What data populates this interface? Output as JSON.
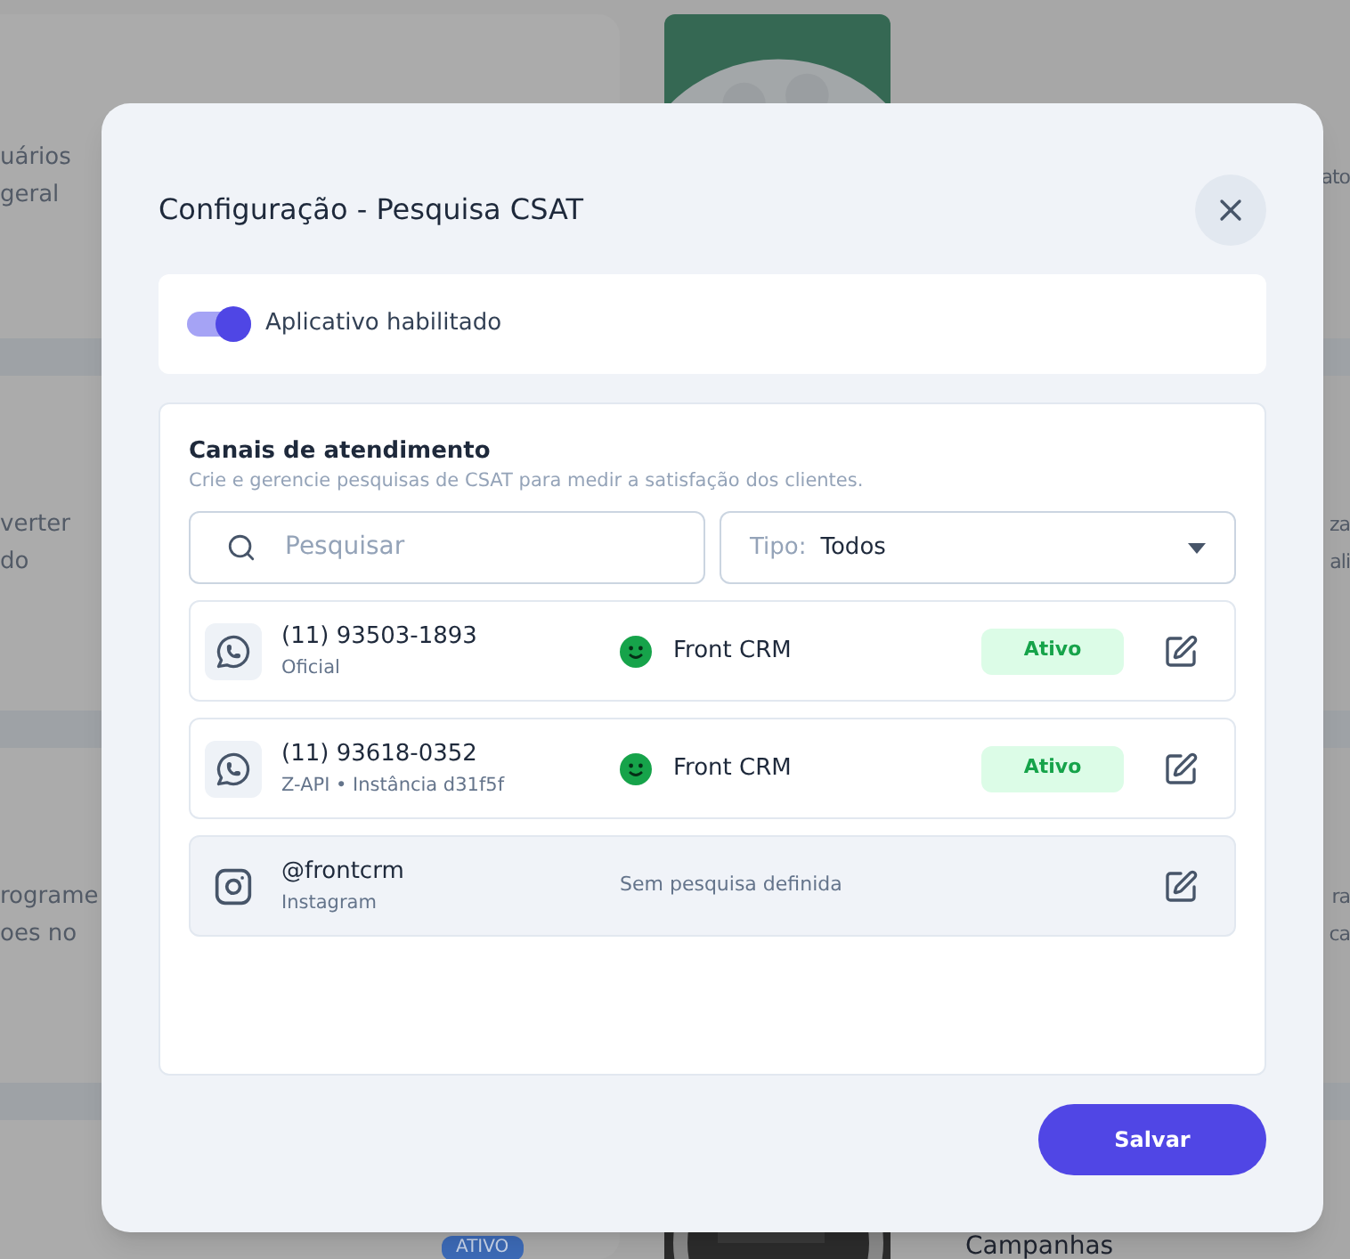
{
  "background": {
    "rows": [
      {
        "left_lines": [
          "uários",
          "geral"
        ],
        "right_lines": [
          "ato"
        ],
        "media": {
          "kind": "picture"
        }
      },
      {
        "left_lines": [
          "verter",
          "do"
        ],
        "right_lines": [
          "za",
          "ali"
        ]
      },
      {
        "left_lines": [
          "rograme",
          "oes no"
        ],
        "right_lines": [
          "ra",
          "ca"
        ]
      },
      {
        "badge": "ATIVO",
        "right_title": "Campanhas",
        "media": {
          "kind": "picture"
        }
      }
    ]
  },
  "dialog": {
    "title": "Configuração - Pesquisa CSAT",
    "app_toggle": {
      "label": "Aplicativo habilitado",
      "on": true
    },
    "channels_section": {
      "title": "Canais de atendimento",
      "subtitle": "Crie e gerencie pesquisas de CSAT para medir a satisfação dos clientes.",
      "search": {
        "placeholder": "Pesquisar"
      },
      "type_filter": {
        "label": "Tipo:",
        "value": "Todos"
      },
      "channels": [
        {
          "kind": "whatsapp",
          "name": "(11) 93503-1893",
          "detail": "Oficial",
          "survey": "Front CRM",
          "status": "Ativo"
        },
        {
          "kind": "whatsapp",
          "name": "(11) 93618-0352",
          "detail": "Z-API • Instância d31f5f",
          "survey": "Front CRM",
          "status": "Ativo"
        },
        {
          "kind": "instagram",
          "name": "@frontcrm",
          "detail": "Instagram",
          "note": "Sem pesquisa definida"
        }
      ]
    },
    "save_button": "Salvar"
  }
}
